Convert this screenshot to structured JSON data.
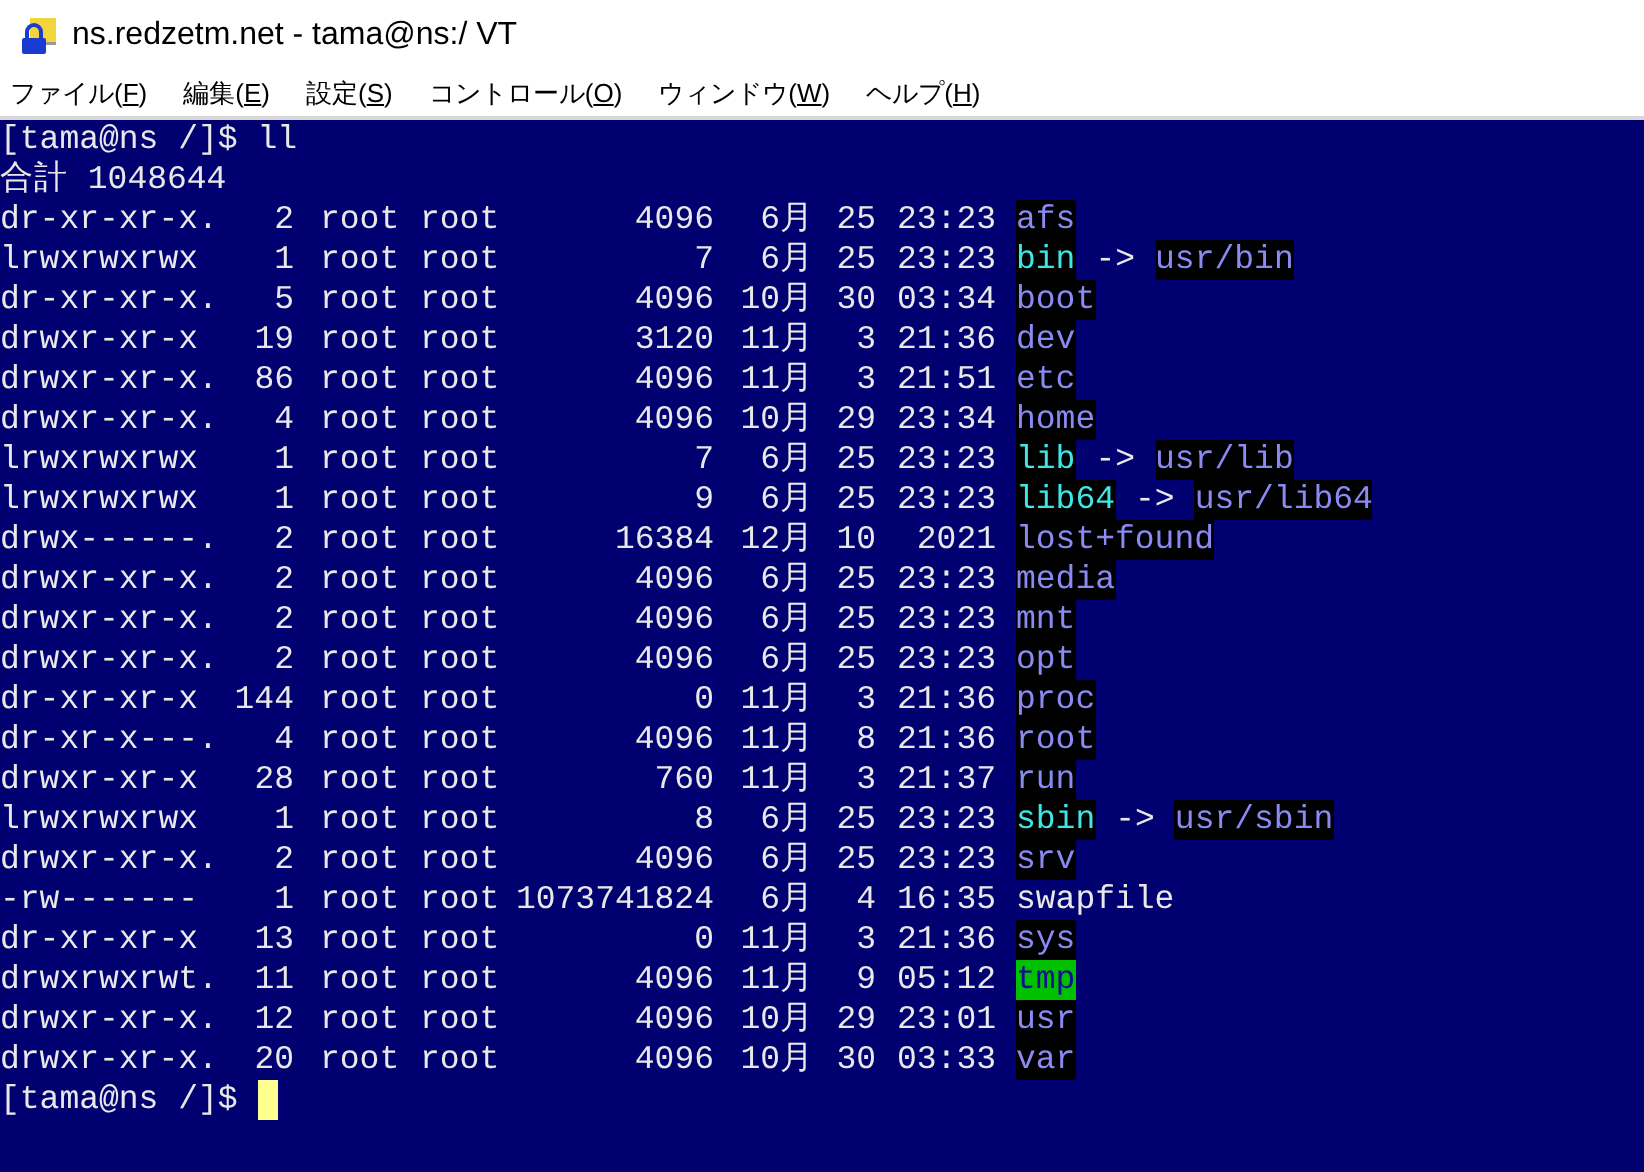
{
  "window": {
    "title": "ns.redzetm.net - tama@ns:/ VT"
  },
  "menu": [
    {
      "label": "ファイル(F)"
    },
    {
      "label": "編集(E)"
    },
    {
      "label": "設定(S)"
    },
    {
      "label": "コントロール(O)"
    },
    {
      "label": "ウィンドウ(W)"
    },
    {
      "label": "ヘルプ(H)"
    }
  ],
  "terminal": {
    "command_line": "[tama@ns /]$ ll",
    "total": "合計 1048644",
    "entries": [
      {
        "perms": "dr-xr-xr-x.",
        "links": "2",
        "owner": "root",
        "group": "root",
        "size": "4096",
        "month": "6月",
        "day": "25",
        "time": "23:23",
        "name": "afs",
        "kind": "dir"
      },
      {
        "perms": "lrwxrwxrwx",
        "links": "1",
        "owner": "root",
        "group": "root",
        "size": "7",
        "month": "6月",
        "day": "25",
        "time": "23:23",
        "name": "bin",
        "kind": "symlink",
        "arrow": "->",
        "target": "usr/bin"
      },
      {
        "perms": "dr-xr-xr-x.",
        "links": "5",
        "owner": "root",
        "group": "root",
        "size": "4096",
        "month": "10月",
        "day": "30",
        "time": "03:34",
        "name": "boot",
        "kind": "dir"
      },
      {
        "perms": "drwxr-xr-x",
        "links": "19",
        "owner": "root",
        "group": "root",
        "size": "3120",
        "month": "11月",
        "day": "3",
        "time": "21:36",
        "name": "dev",
        "kind": "dir"
      },
      {
        "perms": "drwxr-xr-x.",
        "links": "86",
        "owner": "root",
        "group": "root",
        "size": "4096",
        "month": "11月",
        "day": "3",
        "time": "21:51",
        "name": "etc",
        "kind": "dir"
      },
      {
        "perms": "drwxr-xr-x.",
        "links": "4",
        "owner": "root",
        "group": "root",
        "size": "4096",
        "month": "10月",
        "day": "29",
        "time": "23:34",
        "name": "home",
        "kind": "dir"
      },
      {
        "perms": "lrwxrwxrwx",
        "links": "1",
        "owner": "root",
        "group": "root",
        "size": "7",
        "month": "6月",
        "day": "25",
        "time": "23:23",
        "name": "lib",
        "kind": "symlink",
        "arrow": "->",
        "target": "usr/lib"
      },
      {
        "perms": "lrwxrwxrwx",
        "links": "1",
        "owner": "root",
        "group": "root",
        "size": "9",
        "month": "6月",
        "day": "25",
        "time": "23:23",
        "name": "lib64",
        "kind": "symlink",
        "arrow": "->",
        "target": "usr/lib64"
      },
      {
        "perms": "drwx------.",
        "links": "2",
        "owner": "root",
        "group": "root",
        "size": "16384",
        "month": "12月",
        "day": "10",
        "time": "2021",
        "name": "lost+found",
        "kind": "dir"
      },
      {
        "perms": "drwxr-xr-x.",
        "links": "2",
        "owner": "root",
        "group": "root",
        "size": "4096",
        "month": "6月",
        "day": "25",
        "time": "23:23",
        "name": "media",
        "kind": "dir"
      },
      {
        "perms": "drwxr-xr-x.",
        "links": "2",
        "owner": "root",
        "group": "root",
        "size": "4096",
        "month": "6月",
        "day": "25",
        "time": "23:23",
        "name": "mnt",
        "kind": "dir"
      },
      {
        "perms": "drwxr-xr-x.",
        "links": "2",
        "owner": "root",
        "group": "root",
        "size": "4096",
        "month": "6月",
        "day": "25",
        "time": "23:23",
        "name": "opt",
        "kind": "dir"
      },
      {
        "perms": "dr-xr-xr-x",
        "links": "144",
        "owner": "root",
        "group": "root",
        "size": "0",
        "month": "11月",
        "day": "3",
        "time": "21:36",
        "name": "proc",
        "kind": "dir"
      },
      {
        "perms": "dr-xr-x---.",
        "links": "4",
        "owner": "root",
        "group": "root",
        "size": "4096",
        "month": "11月",
        "day": "8",
        "time": "21:36",
        "name": "root",
        "kind": "dir"
      },
      {
        "perms": "drwxr-xr-x",
        "links": "28",
        "owner": "root",
        "group": "root",
        "size": "760",
        "month": "11月",
        "day": "3",
        "time": "21:37",
        "name": "run",
        "kind": "dir"
      },
      {
        "perms": "lrwxrwxrwx",
        "links": "1",
        "owner": "root",
        "group": "root",
        "size": "8",
        "month": "6月",
        "day": "25",
        "time": "23:23",
        "name": "sbin",
        "kind": "symlink",
        "arrow": "->",
        "target": "usr/sbin"
      },
      {
        "perms": "drwxr-xr-x.",
        "links": "2",
        "owner": "root",
        "group": "root",
        "size": "4096",
        "month": "6月",
        "day": "25",
        "time": "23:23",
        "name": "srv",
        "kind": "dir"
      },
      {
        "perms": "-rw-------",
        "links": "1",
        "owner": "root",
        "group": "root",
        "size": "1073741824",
        "month": "6月",
        "day": "4",
        "time": "16:35",
        "name": "swapfile",
        "kind": "file"
      },
      {
        "perms": "dr-xr-xr-x",
        "links": "13",
        "owner": "root",
        "group": "root",
        "size": "0",
        "month": "11月",
        "day": "3",
        "time": "21:36",
        "name": "sys",
        "kind": "dir"
      },
      {
        "perms": "drwxrwxrwt.",
        "links": "11",
        "owner": "root",
        "group": "root",
        "size": "4096",
        "month": "11月",
        "day": "9",
        "time": "05:12",
        "name": "tmp",
        "kind": "sticky_dir"
      },
      {
        "perms": "drwxr-xr-x.",
        "links": "12",
        "owner": "root",
        "group": "root",
        "size": "4096",
        "month": "10月",
        "day": "29",
        "time": "23:01",
        "name": "usr",
        "kind": "dir"
      },
      {
        "perms": "drwxr-xr-x.",
        "links": "20",
        "owner": "root",
        "group": "root",
        "size": "4096",
        "month": "10月",
        "day": "30",
        "time": "03:33",
        "name": "var",
        "kind": "dir"
      }
    ],
    "prompt": "[tama@ns /]$"
  }
}
